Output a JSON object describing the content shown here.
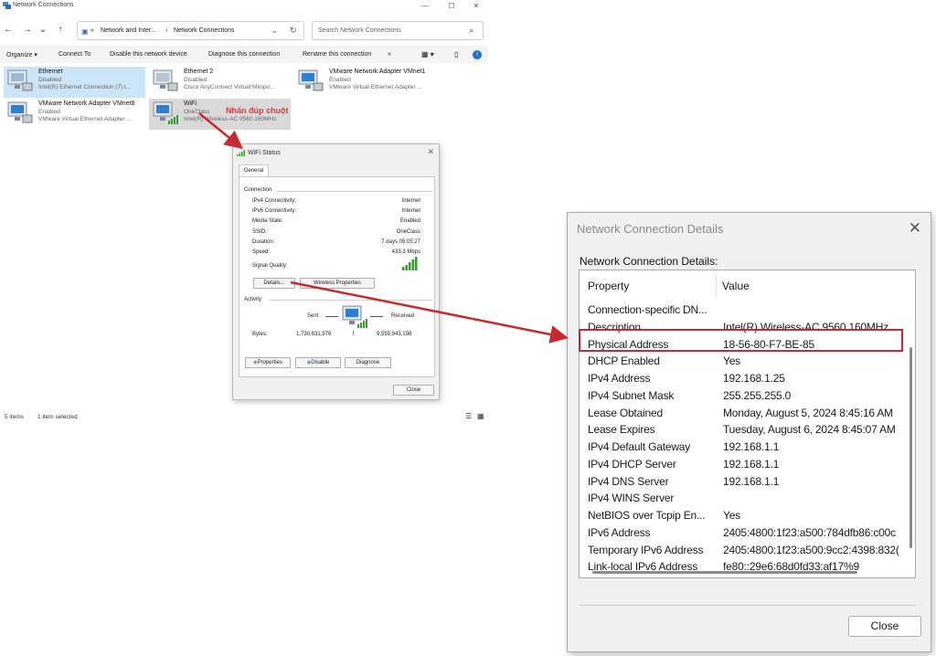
{
  "explorer": {
    "window_title": "Network Connections",
    "address_path": [
      "«",
      "Network and Inter...",
      "›",
      "Network Connections"
    ],
    "search_placeholder": "Search Network Connections",
    "toolbar": [
      "Organize ▾",
      "Connect To",
      "Disable this network device",
      "Diagnose this connection",
      "Rename this connection",
      "»"
    ],
    "adapters": [
      {
        "name": "Ethernet",
        "status": "Disabled",
        "desc": "Intel(R) Ethernet Connection (7) I..."
      },
      {
        "name": "Ethernet 2",
        "status": "Disabled",
        "desc": "Cisco AnyConnect Virtual Minipo..."
      },
      {
        "name": "VMware Network Adapter VMnet1",
        "status": "Enabled",
        "desc": "VMware Virtual Ethernet Adapter ..."
      },
      {
        "name": "VMware Network Adapter VMnet8",
        "status": "Enabled",
        "desc": "VMware Virtual Ethernet Adapter ..."
      },
      {
        "name": "WiFi",
        "status": "OneClass",
        "desc": "Intel(R) Wireless-AC 9560 160MHz"
      }
    ],
    "status_items": "5 items",
    "status_selected": "1 item selected"
  },
  "annotation": "Nhấn đúp chuột",
  "wifi_status": {
    "title": "WiFi Status",
    "tab": "General",
    "connection_label": "Connection",
    "rows": [
      {
        "k": "IPv4 Connectivity:",
        "v": "Internet"
      },
      {
        "k": "IPv6 Connectivity:",
        "v": "Internet"
      },
      {
        "k": "Media State:",
        "v": "Enabled"
      },
      {
        "k": "SSID:",
        "v": "OneClass"
      },
      {
        "k": "Duration:",
        "v": "7 days 05:05:27"
      },
      {
        "k": "Speed:",
        "v": "433.3 Mbps"
      }
    ],
    "signal_label": "Signal Quality:",
    "details_btn": "Details...",
    "wireless_btn": "Wireless Properties",
    "activity_label": "Activity",
    "sent_label": "Sent",
    "received_label": "Received",
    "bytes_label": "Bytes:",
    "bytes_sent": "1,730,831,976",
    "bytes_received": "9,555,943,198",
    "properties_btn": "Properties",
    "disable_btn": "Disable",
    "diagnose_btn": "Diagnose",
    "close_btn": "Close"
  },
  "details": {
    "title": "Network Connection Details",
    "label": "Network Connection Details:",
    "col_property": "Property",
    "col_value": "Value",
    "rows": [
      {
        "p": "Connection-specific DN...",
        "v": ""
      },
      {
        "p": "Description",
        "v": "Intel(R) Wireless-AC 9560 160MHz"
      },
      {
        "p": "Physical Address",
        "v": "18-56-80-F7-BE-85"
      },
      {
        "p": "DHCP Enabled",
        "v": "Yes"
      },
      {
        "p": "IPv4 Address",
        "v": "192.168.1.25"
      },
      {
        "p": "IPv4 Subnet Mask",
        "v": "255.255.255.0"
      },
      {
        "p": "Lease Obtained",
        "v": "Monday, August 5, 2024 8:45:16 AM"
      },
      {
        "p": "Lease Expires",
        "v": "Tuesday, August 6, 2024 8:45:07 AM"
      },
      {
        "p": "IPv4 Default Gateway",
        "v": "192.168.1.1"
      },
      {
        "p": "IPv4 DHCP Server",
        "v": "192.168.1.1"
      },
      {
        "p": "IPv4 DNS Server",
        "v": "192.168.1.1"
      },
      {
        "p": "IPv4 WINS Server",
        "v": ""
      },
      {
        "p": "NetBIOS over Tcpip En...",
        "v": "Yes"
      },
      {
        "p": "IPv6 Address",
        "v": "2405:4800:1f23:a500:784dfb86:c00c"
      },
      {
        "p": "Temporary IPv6 Address",
        "v": "2405:4800:1f23:a500:9cc2:4398:832("
      },
      {
        "p": "Link-local IPv6 Address",
        "v": "fe80::29e6:68d0fd33:af17%9"
      }
    ],
    "close_btn": "Close"
  },
  "colors": {
    "annotation": "#d93a3a",
    "selection": "#cce4f7",
    "highlight_box": "#c8282f"
  }
}
